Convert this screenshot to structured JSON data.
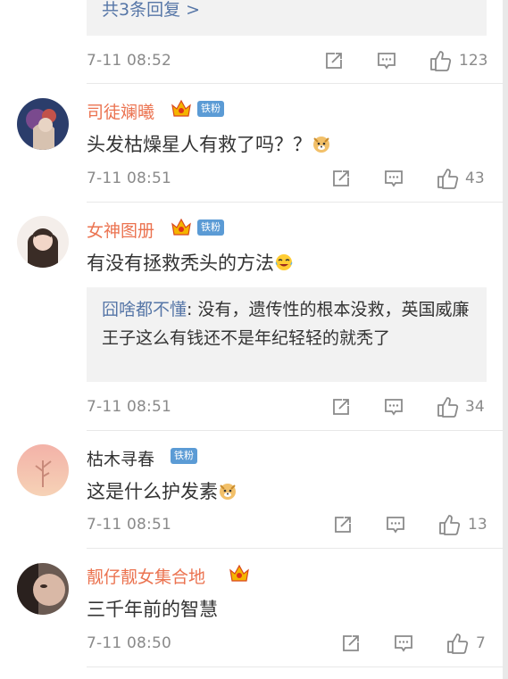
{
  "top_reply_more": "共3条回复 >",
  "comments": [
    {
      "time": "7-11 08:52",
      "likes": "123"
    },
    {
      "name": "司徒斓曦",
      "badge": "铁粉",
      "text": "头发枯燥星人有救了吗？？",
      "time": "7-11 08:51",
      "likes": "43"
    },
    {
      "name": "女神图册",
      "badge": "铁粉",
      "text": "有没有拯救秃头的方法",
      "reply_name": "囧啥都不懂",
      "reply_text": ": 没有，遗传性的根本没救，英国威廉王子这么有钱还不是年纪轻轻的就秃了",
      "time": "7-11 08:51",
      "likes": "34"
    },
    {
      "name": "枯木寻春",
      "badge": "铁粉",
      "text": "这是什么护发素",
      "time": "7-11 08:51",
      "likes": "13"
    },
    {
      "name": "靓仔靓女集合地",
      "text": "三千年前的智慧",
      "time": "7-11 08:50",
      "likes": "7"
    }
  ],
  "colors": {
    "vip_name": "#eb7350",
    "link": "#5676a7",
    "badge": "#5b9bd5",
    "meta": "#8a8a8a"
  },
  "icons": {
    "share": "share-icon",
    "comment": "comment-icon",
    "like": "thumbs-up-icon",
    "crown": "crown-icon",
    "emoji": "doge-emoji-icon"
  }
}
